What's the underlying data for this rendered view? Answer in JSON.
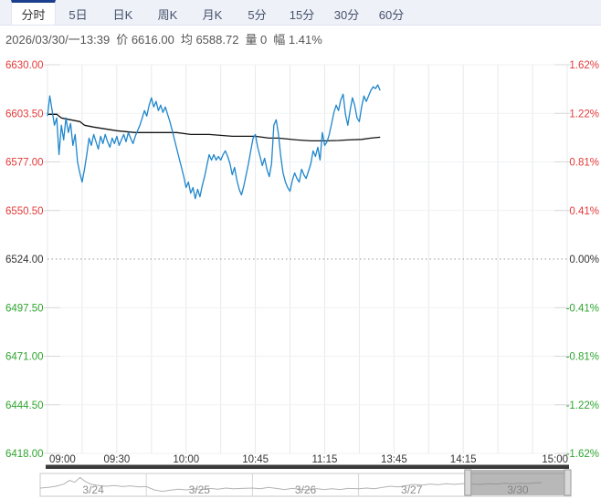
{
  "tabs": {
    "items": [
      {
        "label": "分时",
        "active": true
      },
      {
        "label": "5日",
        "active": false
      },
      {
        "label": "日K",
        "active": false
      },
      {
        "label": "周K",
        "active": false
      },
      {
        "label": "月K",
        "active": false
      },
      {
        "label": "5分",
        "active": false
      },
      {
        "label": "15分",
        "active": false
      },
      {
        "label": "30分",
        "active": false
      },
      {
        "label": "60分",
        "active": false
      }
    ]
  },
  "info": {
    "datetime": "2026/03/30/一13:39",
    "price": "价 6616.00",
    "avg": "均 6588.72",
    "volume": "量 0",
    "range": "幅 1.41%"
  },
  "colors": {
    "up": "#e23a3a",
    "down": "#2fa52f",
    "neutral": "#333333",
    "price_line": "#1f86cc",
    "avg_line": "#141414",
    "grid_v": "#e7e9ec",
    "grid_h": "#f0f1f3",
    "prev_close_line": "#9a9a9a",
    "tab_accent": "#1a3f8e",
    "nav_line": "#b3b3b3",
    "nav_text": "#8c8c8c",
    "nav_border": "#c8c8c8",
    "nav_highlight": "rgba(125,125,125,0.55)",
    "nav_handle": "#d9d9d9",
    "dark_bar": "#3a3a3a",
    "time_text": "#333333"
  },
  "chart_data": {
    "type": "line",
    "title": "分时走势",
    "x_axis": {
      "total_minutes": 225,
      "grid_interval_minutes": 15,
      "ticks": [
        {
          "label": "09:00",
          "min": 0
        },
        {
          "label": "09:30",
          "min": 30
        },
        {
          "label": "10:00",
          "min": 60
        },
        {
          "label": "10:45",
          "min": 90
        },
        {
          "label": "11:15",
          "min": 120
        },
        {
          "label": "13:45",
          "min": 150
        },
        {
          "label": "14:15",
          "min": 180
        },
        {
          "label": "15:00",
          "min": 225
        }
      ]
    },
    "y_axis": {
      "max": 6630.0,
      "min": 6418.0,
      "prev_close": 6524.0,
      "price_labels": [
        "6630.00",
        "6603.50",
        "6577.00",
        "6550.50",
        "6524.00",
        "6497.50",
        "6471.00",
        "6444.50",
        "6418.00"
      ],
      "pct_labels": [
        "1.62%",
        "1.22%",
        "0.81%",
        "0.41%",
        "0.00%",
        "-0.41%",
        "-0.81%",
        "-1.22%",
        "-1.62%"
      ]
    },
    "series": [
      {
        "name": "price",
        "values": [
          [
            0,
            6602
          ],
          [
            1,
            6613
          ],
          [
            2,
            6605
          ],
          [
            3,
            6597
          ],
          [
            4,
            6601
          ],
          [
            5,
            6581
          ],
          [
            6,
            6597
          ],
          [
            7,
            6589
          ],
          [
            8,
            6601
          ],
          [
            9,
            6593
          ],
          [
            10,
            6598
          ],
          [
            11,
            6586
          ],
          [
            12,
            6592
          ],
          [
            13,
            6577
          ],
          [
            14,
            6571
          ],
          [
            15,
            6566
          ],
          [
            16,
            6573
          ],
          [
            17,
            6581
          ],
          [
            18,
            6590
          ],
          [
            19,
            6586
          ],
          [
            20,
            6592
          ],
          [
            21,
            6588
          ],
          [
            22,
            6584
          ],
          [
            23,
            6591
          ],
          [
            24,
            6587
          ],
          [
            25,
            6592
          ],
          [
            26,
            6588
          ],
          [
            27,
            6585
          ],
          [
            28,
            6590
          ],
          [
            29,
            6587
          ],
          [
            30,
            6591
          ],
          [
            31,
            6586
          ],
          [
            32,
            6589
          ],
          [
            33,
            6592
          ],
          [
            34,
            6588
          ],
          [
            35,
            6593
          ],
          [
            36,
            6590
          ],
          [
            37,
            6587
          ],
          [
            38,
            6591
          ],
          [
            39,
            6594
          ],
          [
            40,
            6597
          ],
          [
            41,
            6601
          ],
          [
            42,
            6605
          ],
          [
            43,
            6602
          ],
          [
            44,
            6608
          ],
          [
            45,
            6612
          ],
          [
            46,
            6607
          ],
          [
            47,
            6610
          ],
          [
            48,
            6605
          ],
          [
            49,
            6608
          ],
          [
            50,
            6604
          ],
          [
            51,
            6607
          ],
          [
            52,
            6603
          ],
          [
            53,
            6599
          ],
          [
            54,
            6594
          ],
          [
            55,
            6589
          ],
          [
            56,
            6584
          ],
          [
            57,
            6579
          ],
          [
            58,
            6574
          ],
          [
            59,
            6569
          ],
          [
            60,
            6563
          ],
          [
            61,
            6566
          ],
          [
            62,
            6560
          ],
          [
            63,
            6563
          ],
          [
            64,
            6557
          ],
          [
            65,
            6562
          ],
          [
            66,
            6558
          ],
          [
            67,
            6564
          ],
          [
            68,
            6569
          ],
          [
            69,
            6575
          ],
          [
            70,
            6581
          ],
          [
            71,
            6578
          ],
          [
            72,
            6581
          ],
          [
            73,
            6578
          ],
          [
            74,
            6580
          ],
          [
            75,
            6578
          ],
          [
            76,
            6581
          ],
          [
            77,
            6583
          ],
          [
            78,
            6580
          ],
          [
            79,
            6576
          ],
          [
            80,
            6570
          ],
          [
            81,
            6574
          ],
          [
            82,
            6567
          ],
          [
            83,
            6562
          ],
          [
            84,
            6559
          ],
          [
            85,
            6564
          ],
          [
            86,
            6570
          ],
          [
            87,
            6576
          ],
          [
            88,
            6583
          ],
          [
            89,
            6590
          ],
          [
            90,
            6592
          ],
          [
            91,
            6585
          ],
          [
            92,
            6580
          ],
          [
            93,
            6575
          ],
          [
            94,
            6579
          ],
          [
            95,
            6573
          ],
          [
            96,
            6569
          ],
          [
            97,
            6576
          ],
          [
            98,
            6597
          ],
          [
            99,
            6600
          ],
          [
            100,
            6592
          ],
          [
            101,
            6580
          ],
          [
            102,
            6571
          ],
          [
            103,
            6566
          ],
          [
            104,
            6563
          ],
          [
            105,
            6561
          ],
          [
            106,
            6567
          ],
          [
            107,
            6571
          ],
          [
            108,
            6568
          ],
          [
            109,
            6566
          ],
          [
            110,
            6573
          ],
          [
            111,
            6570
          ],
          [
            112,
            6568
          ],
          [
            113,
            6572
          ],
          [
            114,
            6576
          ],
          [
            115,
            6583
          ],
          [
            116,
            6580
          ],
          [
            117,
            6585
          ],
          [
            118,
            6578
          ],
          [
            119,
            6593
          ],
          [
            120,
            6586
          ],
          [
            121,
            6588
          ],
          [
            122,
            6592
          ],
          [
            123,
            6598
          ],
          [
            124,
            6604
          ],
          [
            125,
            6608
          ],
          [
            126,
            6605
          ],
          [
            127,
            6611
          ],
          [
            128,
            6614
          ],
          [
            129,
            6603
          ],
          [
            130,
            6597
          ],
          [
            131,
            6605
          ],
          [
            132,
            6612
          ],
          [
            133,
            6608
          ],
          [
            134,
            6601
          ],
          [
            135,
            6599
          ],
          [
            136,
            6607
          ],
          [
            137,
            6613
          ],
          [
            138,
            6610
          ],
          [
            139,
            6613
          ],
          [
            140,
            6616
          ],
          [
            141,
            6618
          ],
          [
            142,
            6617
          ],
          [
            143,
            6619
          ],
          [
            144,
            6616
          ]
        ]
      },
      {
        "name": "avg",
        "values": [
          [
            0,
            6603
          ],
          [
            4,
            6603
          ],
          [
            6,
            6601
          ],
          [
            10,
            6600
          ],
          [
            14,
            6599
          ],
          [
            16,
            6597
          ],
          [
            20,
            6596
          ],
          [
            25,
            6595
          ],
          [
            30,
            6594
          ],
          [
            38,
            6593
          ],
          [
            48,
            6593
          ],
          [
            56,
            6593
          ],
          [
            62,
            6592
          ],
          [
            70,
            6592
          ],
          [
            80,
            6591
          ],
          [
            90,
            6591
          ],
          [
            96,
            6590
          ],
          [
            100,
            6590
          ],
          [
            108,
            6589
          ],
          [
            114,
            6588.5
          ],
          [
            120,
            6588.5
          ],
          [
            126,
            6588.7
          ],
          [
            130,
            6589
          ],
          [
            136,
            6589.3
          ],
          [
            140,
            6590
          ],
          [
            144,
            6590.5
          ]
        ]
      }
    ],
    "navigator": {
      "dates": [
        "3/24",
        "3/25",
        "3/26",
        "3/27",
        "3/30"
      ],
      "selected_index": 4,
      "spark": [
        [
          0,
          0.3
        ],
        [
          0.015,
          0.34
        ],
        [
          0.03,
          0.4
        ],
        [
          0.045,
          0.52
        ],
        [
          0.055,
          0.72
        ],
        [
          0.065,
          0.62
        ],
        [
          0.075,
          0.88
        ],
        [
          0.085,
          0.66
        ],
        [
          0.095,
          0.52
        ],
        [
          0.11,
          0.44
        ],
        [
          0.125,
          0.4
        ],
        [
          0.14,
          0.44
        ],
        [
          0.155,
          0.38
        ],
        [
          0.17,
          0.42
        ],
        [
          0.185,
          0.36
        ],
        [
          0.2,
          0.38
        ],
        [
          0.215,
          0.2
        ],
        [
          0.23,
          0.12
        ],
        [
          0.245,
          0.18
        ],
        [
          0.26,
          0.24
        ],
        [
          0.275,
          0.2
        ],
        [
          0.29,
          0.26
        ],
        [
          0.305,
          0.22
        ],
        [
          0.32,
          0.28
        ],
        [
          0.335,
          0.24
        ],
        [
          0.35,
          0.3
        ],
        [
          0.365,
          0.26
        ],
        [
          0.38,
          0.28
        ],
        [
          0.4,
          0.3
        ],
        [
          0.415,
          0.26
        ],
        [
          0.43,
          0.34
        ],
        [
          0.445,
          0.28
        ],
        [
          0.46,
          0.22
        ],
        [
          0.475,
          0.28
        ],
        [
          0.49,
          0.24
        ],
        [
          0.505,
          0.2
        ],
        [
          0.52,
          0.27
        ],
        [
          0.535,
          0.22
        ],
        [
          0.55,
          0.26
        ],
        [
          0.565,
          0.22
        ],
        [
          0.58,
          0.28
        ],
        [
          0.6,
          0.26
        ],
        [
          0.615,
          0.3
        ],
        [
          0.63,
          0.26
        ],
        [
          0.645,
          0.34
        ],
        [
          0.66,
          0.4
        ],
        [
          0.675,
          0.36
        ],
        [
          0.69,
          0.44
        ],
        [
          0.705,
          0.5
        ],
        [
          0.72,
          0.46
        ],
        [
          0.735,
          0.52
        ],
        [
          0.75,
          0.48
        ],
        [
          0.765,
          0.54
        ],
        [
          0.78,
          0.5
        ],
        [
          0.8,
          0.55
        ],
        [
          0.815,
          0.52
        ],
        [
          0.83,
          0.5
        ],
        [
          0.845,
          0.54
        ],
        [
          0.86,
          0.52
        ],
        [
          0.875,
          0.56
        ],
        [
          0.89,
          0.54
        ],
        [
          0.905,
          0.57
        ],
        [
          0.92,
          0.55
        ],
        [
          0.935,
          0.58
        ],
        [
          0.945,
          0.6
        ]
      ]
    }
  }
}
